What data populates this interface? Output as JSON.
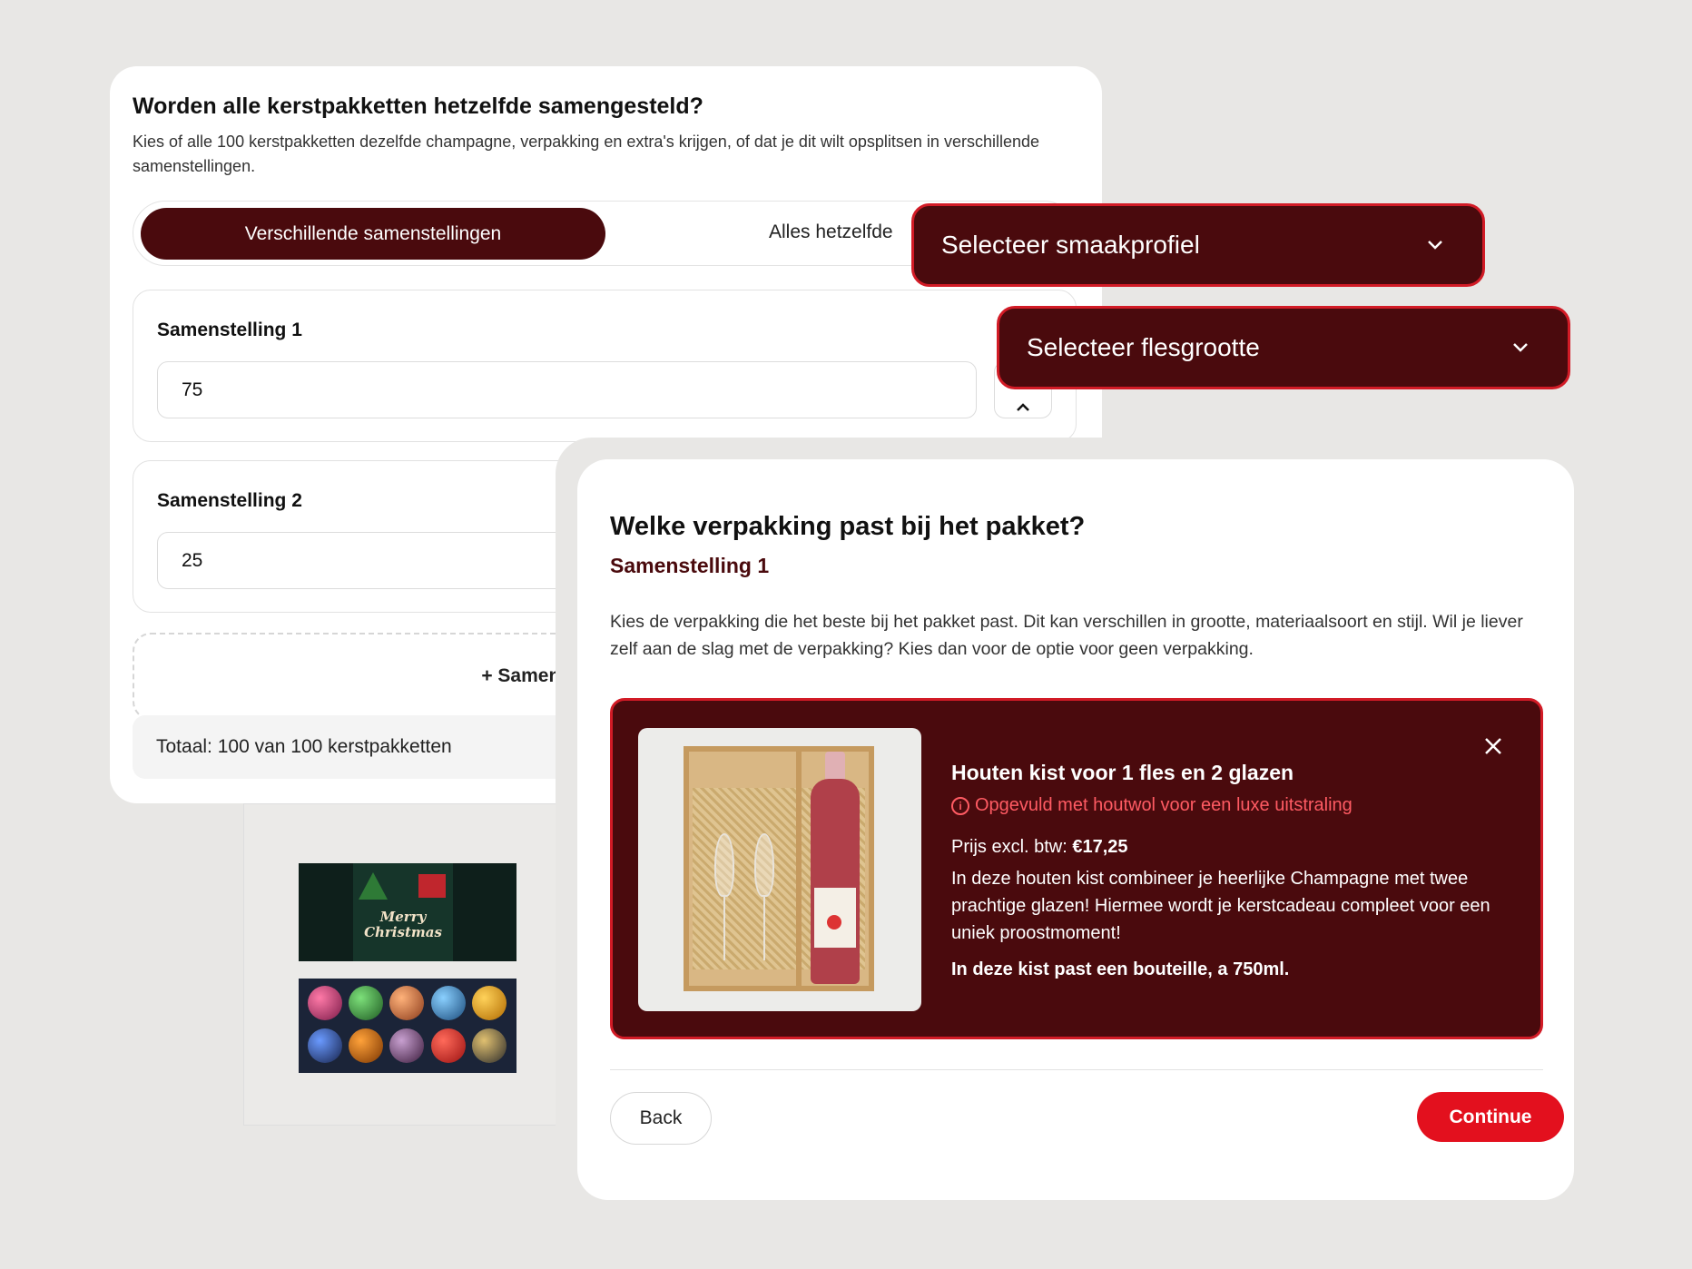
{
  "composition_step": {
    "title": "Worden alle kerstpakketten hetzelfde samengesteld?",
    "description": "Kies of alle 100 kerstpakketten dezelfde champagne, verpakking en extra's krijgen, of dat je dit wilt opsplitsen in verschillende samenstellingen.",
    "toggle": {
      "active_label": "Verschillende samenstellingen",
      "other_label": "Alles hetzelfde"
    },
    "compositions": [
      {
        "label": "Samenstelling 1",
        "quantity": "75",
        "side_icon": "chevron-up-icon"
      },
      {
        "label": "Samenstelling 2",
        "quantity": "25"
      }
    ],
    "add_label": "+ Samenstelling toevoegen",
    "total_label": "Totaal: 100 van 100 kerstpakketten"
  },
  "product_image": {
    "lid_text_line1": "Merry",
    "lid_text_line2": "Christmas"
  },
  "dropdowns": {
    "taste_profile": "Selecteer smaakprofiel",
    "bottle_size": "Selecteer flesgrootte",
    "icon": "chevron-down-icon"
  },
  "modal": {
    "title": "Welke verpakking past bij het pakket?",
    "subtitle": "Samenstelling 1",
    "description": "Kies de verpakking die het beste bij het pakket past. Dit kan verschillen in grootte, materiaalsoort en stijl. Wil je liever zelf aan de slag met de verpakking? Kies dan voor de optie voor geen verpakking.",
    "option": {
      "title": "Houten kist voor 1 fles en 2 glazen",
      "note": "Opgevuld met houtwol voor een luxe uitstraling",
      "price_label": "Prijs excl. btw:",
      "price_value": "€17,25",
      "text": "In deze houten kist combineer je heerlijke Champagne met twee prachtige glazen! Hiermee wordt je kerstcadeau compleet voor een uniek proostmoment!",
      "fit": "In deze kist past een bouteille, a 750ml."
    },
    "back_label": "Back",
    "continue_label": "Continue"
  },
  "colors": {
    "accent_dark": "#4a0a0d",
    "accent_red": "#e3101e",
    "border_red": "#d21b26",
    "note_red": "#ff5b63"
  }
}
